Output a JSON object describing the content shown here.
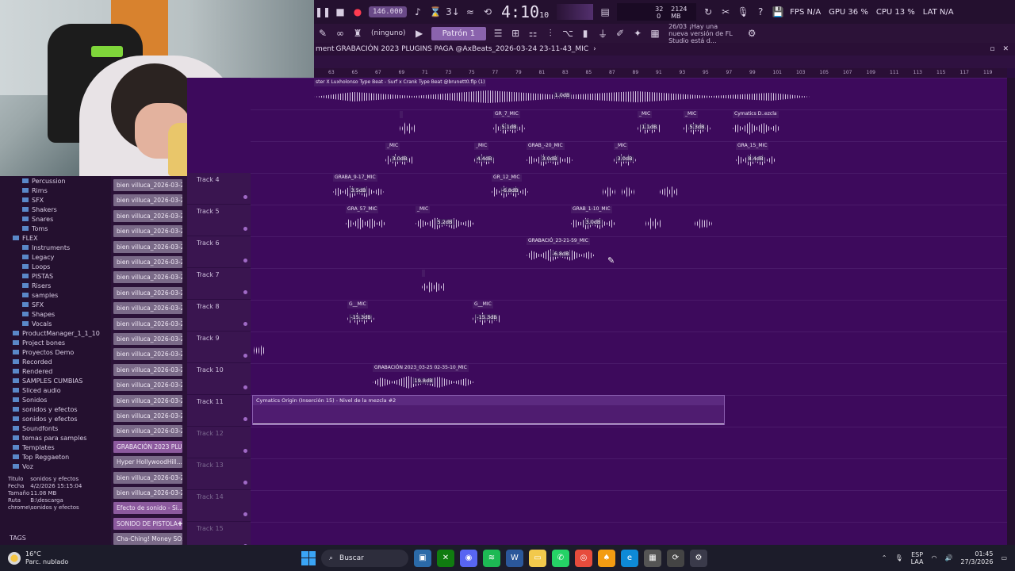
{
  "toolbar": {
    "tempo": "146.000",
    "time": "4:10",
    "time_small": "10",
    "meter_top": "32",
    "meter_mem": "2124 MB",
    "meter_bottom": "0",
    "fps": "FPS N/A",
    "gpu": "GPU 36 %",
    "cpu": "CPU 13 %",
    "lat": "LAT N/A"
  },
  "toolbar2": {
    "channel_filter": "(ninguno)",
    "pattern": "Patrón 1",
    "news_date": "26/03",
    "news_text": "¡Hay una nueva versión de FL Studio está d..."
  },
  "titlebar": {
    "prefix": "ment",
    "title": "GRABACIÓN 2023 PLUGINS PAGA @AxBeats_2026-03-24 23-11-43_MIC"
  },
  "ruler": [
    "63",
    "65",
    "67",
    "69",
    "71",
    "73",
    "75",
    "77",
    "79",
    "81",
    "83",
    "85",
    "87",
    "89",
    "91",
    "93",
    "95",
    "97",
    "99",
    "101",
    "103",
    "105",
    "107",
    "109",
    "111",
    "113",
    "115",
    "117",
    "119"
  ],
  "browser": {
    "items": [
      {
        "label": "Percussion",
        "sub": true
      },
      {
        "label": "Rims",
        "sub": true
      },
      {
        "label": "SFX",
        "sub": true
      },
      {
        "label": "Shakers",
        "sub": true
      },
      {
        "label": "Snares",
        "sub": true
      },
      {
        "label": "Toms",
        "sub": true
      },
      {
        "label": "FLEX",
        "sub": false
      },
      {
        "label": "Instruments",
        "sub": true
      },
      {
        "label": "Legacy",
        "sub": true
      },
      {
        "label": "Loops",
        "sub": true
      },
      {
        "label": "PISTAS",
        "sub": true
      },
      {
        "label": "Risers",
        "sub": true
      },
      {
        "label": "samples",
        "sub": true
      },
      {
        "label": "SFX",
        "sub": true
      },
      {
        "label": "Shapes",
        "sub": true
      },
      {
        "label": "Vocals",
        "sub": true
      },
      {
        "label": "ProductManager_1_1_10",
        "sub": false
      },
      {
        "label": "Project bones",
        "sub": false
      },
      {
        "label": "Proyectos Demo",
        "sub": false
      },
      {
        "label": "Recorded",
        "sub": false
      },
      {
        "label": "Rendered",
        "sub": false
      },
      {
        "label": "SAMPLES CUMBIAS",
        "sub": false
      },
      {
        "label": "Sliced audio",
        "sub": false
      },
      {
        "label": "Sonidos",
        "sub": false
      },
      {
        "label": "sonidos y efectos",
        "sub": false
      },
      {
        "label": "sonidos y efectos",
        "sub": false
      },
      {
        "label": "Soundfonts",
        "sub": false
      },
      {
        "label": "temas para samples",
        "sub": false
      },
      {
        "label": "Templates",
        "sub": false
      },
      {
        "label": "Top Reggaeton",
        "sub": false
      },
      {
        "label": "Voz",
        "sub": false
      }
    ],
    "info": {
      "titulo_k": "Titulo",
      "titulo_v": "sonidos y efectos",
      "fecha_k": "Fecha",
      "fecha_v": "4/2/2026 15:15:04",
      "tamano_k": "Tamaño",
      "tamano_v": "11.08 MB",
      "ruta_k": "Ruta",
      "ruta_v": "B:\\descarga chrome\\sonidos y efectos"
    },
    "tags": "TAGS"
  },
  "channels": [
    {
      "label": "bien villuca_2026-03-26_",
      "hl": false,
      "plus": false
    },
    {
      "label": "bien villuca_2026-03-27_",
      "hl": false,
      "plus": false
    },
    {
      "label": "bien villuca_2026-03-27_",
      "hl": false,
      "plus": false
    },
    {
      "label": "bien villuca_2026-03-27_",
      "hl": false,
      "plus": false
    },
    {
      "label": "bien villuca_2026-03-27_",
      "hl": false,
      "plus": false
    },
    {
      "label": "bien villuca_2026-03-27_",
      "hl": false,
      "plus": false
    },
    {
      "label": "bien villuca_2026-03-27_",
      "hl": false,
      "plus": false
    },
    {
      "label": "bien villuca_2026-03-27_",
      "hl": false,
      "plus": false
    },
    {
      "label": "bien villuca_2026-03-27_",
      "hl": false,
      "plus": false
    },
    {
      "label": "bien villuca_2026-03-27_",
      "hl": false,
      "plus": false
    },
    {
      "label": "bien villuca_2026-03-27_",
      "hl": false,
      "plus": false
    },
    {
      "label": "bien villuca_2026-03-27_",
      "hl": false,
      "plus": false
    },
    {
      "label": "bien villuca_2026-03-27_",
      "hl": false,
      "plus": false
    },
    {
      "label": "bien villuca_2026-03-27_",
      "hl": false,
      "plus": false
    },
    {
      "label": "bien villuca_2026-03-27_",
      "hl": false,
      "plus": false
    },
    {
      "label": "bien villuca_2026-03-27_",
      "hl": false,
      "plus": false
    },
    {
      "label": "bien villuca_2026-03-27_",
      "hl": false,
      "plus": false
    },
    {
      "label": "GRABACIÓN 2023 PLU...",
      "hl": true,
      "plus": true
    },
    {
      "label": "Hyper HollywoodHill...",
      "hl": false,
      "plus": true
    },
    {
      "label": "bien villuca_2026-03-27_",
      "hl": false,
      "plus": false
    },
    {
      "label": "bien villuca_2026-03-27_",
      "hl": false,
      "plus": false
    },
    {
      "label": "Efecto de sonido - Si...",
      "hl": true,
      "plus": true
    },
    {
      "label": "SONIDO DE PISTOLA",
      "hl": true,
      "plus": true
    },
    {
      "label": "Cha-Ching! Money SO...",
      "hl": false,
      "plus": true
    }
  ],
  "tracks": [
    {
      "label": "Track 4",
      "dim": false
    },
    {
      "label": "Track 5",
      "dim": false
    },
    {
      "label": "Track 6",
      "dim": false
    },
    {
      "label": "Track 7",
      "dim": false
    },
    {
      "label": "Track 8",
      "dim": false
    },
    {
      "label": "Track 9",
      "dim": false
    },
    {
      "label": "Track 10",
      "dim": false
    },
    {
      "label": "Track 11",
      "dim": false
    },
    {
      "label": "Track 12",
      "dim": true
    },
    {
      "label": "Track 13",
      "dim": true
    },
    {
      "label": "Track 14",
      "dim": true
    },
    {
      "label": "Track 15",
      "dim": true
    }
  ],
  "clips": [
    {
      "name": "ster X Luxholonso Type Beat - Surf x Crank Type Beat @brunett0.flp (1)",
      "db": "1.0dB"
    },
    {
      "name": "",
      "db": ""
    },
    {
      "name": "GR_7_MIC",
      "db": "5.1dB"
    },
    {
      "name": "_MIC",
      "db": "1.1dB"
    },
    {
      "name": "_MIC",
      "db": "5.3dB"
    },
    {
      "name": "Cymatics D..ezcla",
      "db": ""
    },
    {
      "name": "_MIC",
      "db": "3.0dB"
    },
    {
      "name": "_MIC",
      "db": "4.4dB"
    },
    {
      "name": "GRAB_-20_MIC",
      "db": "3.0dB"
    },
    {
      "name": "_MIC",
      "db": "3.0dB"
    },
    {
      "name": "GRA_15_MIC",
      "db": "8.4dB"
    },
    {
      "name": "GRABA_9-17_MIC",
      "db": "3.5dB"
    },
    {
      "name": "GR_12_MIC",
      "db": "-6.8dB"
    },
    {
      "name": "GRA_57_MIC",
      "db": ""
    },
    {
      "name": "_MIC",
      "db": "5.2dB"
    },
    {
      "name": "GRAB_1-10_MIC",
      "db": "3.0dB"
    },
    {
      "name": "GRABACIÓ_23-21-59_MIC",
      "db": "-6.8dB"
    },
    {
      "name": "",
      "db": ""
    },
    {
      "name": "G__MIC",
      "db": "-15.3dB"
    },
    {
      "name": "G__MIC",
      "db": "-15.3dB"
    },
    {
      "name": "GRABACIÓN 2023_03-25 02-35-10_MIC",
      "db": "19.8dB"
    }
  ],
  "automation": {
    "name": "Cymatics Origin (Inserción 15) - Nivel de la mezcla #2"
  },
  "taskbar": {
    "temp": "16°C",
    "weather": "Parc. nublado",
    "search": "Buscar",
    "lang1": "ESP",
    "lang2": "LAA",
    "time": "01:45",
    "date": "27/3/2026"
  }
}
